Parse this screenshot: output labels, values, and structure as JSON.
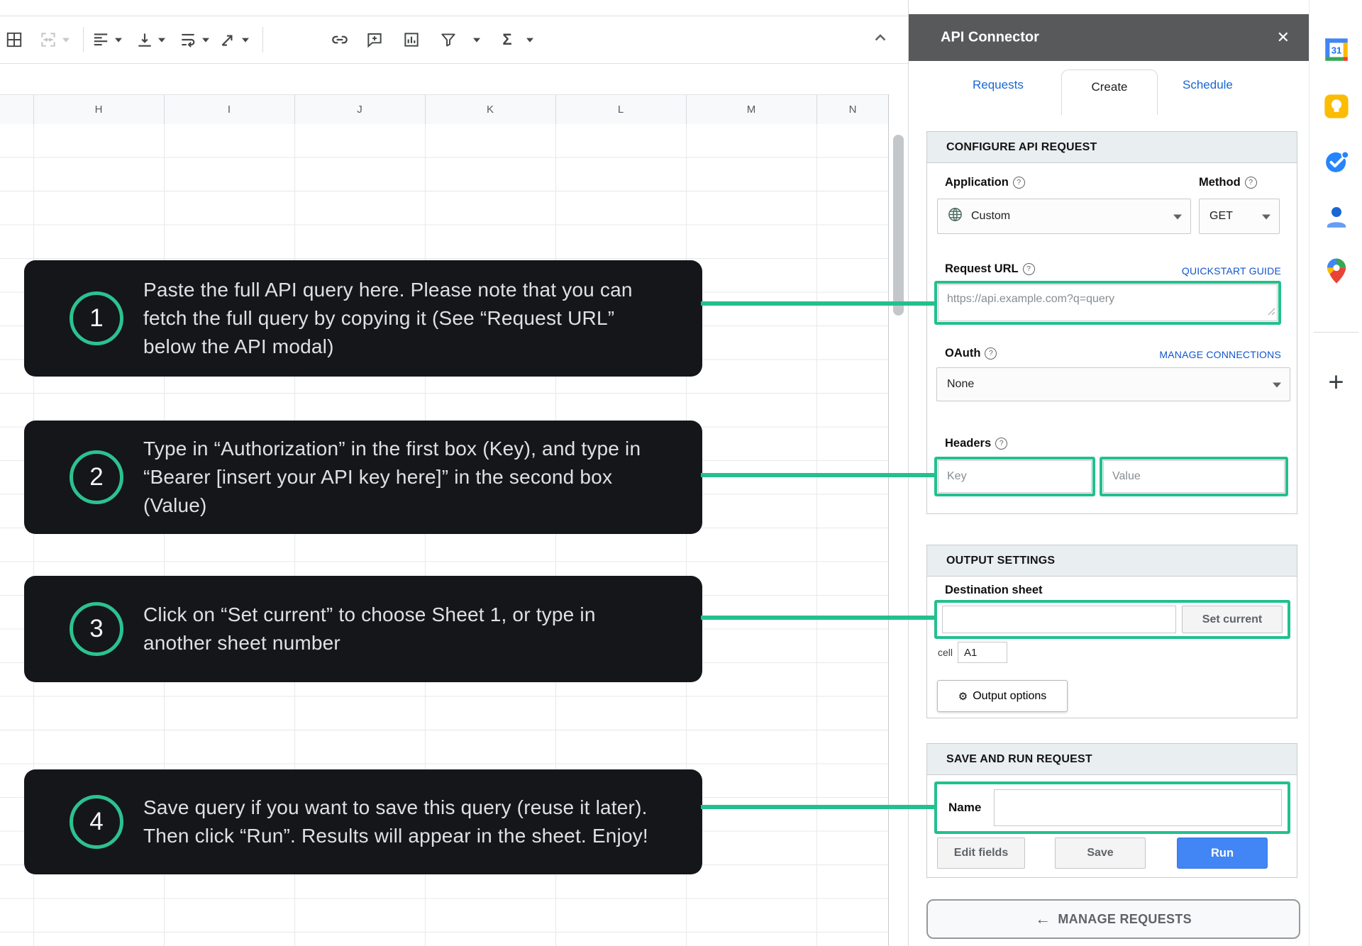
{
  "colors": {
    "accent_green": "#22c08e",
    "run_blue": "#4285f4",
    "link_blue": "#1155cc",
    "tab_blue": "#1967d2",
    "panel_header_gray": "#58595b",
    "callout_bg": "#14161a"
  },
  "toolbar": {
    "icons": [
      "borders",
      "merge-cells",
      "horizontal-align",
      "vertical-align",
      "text-wrap",
      "text-rotation",
      "insert-link",
      "insert-comment",
      "insert-chart",
      "create-filter",
      "functions"
    ],
    "sigma_glyph": "Σ"
  },
  "sheet": {
    "columns": [
      "H",
      "I",
      "J",
      "K",
      "L",
      "M",
      "N"
    ]
  },
  "callouts": [
    {
      "number": "1",
      "lines": [
        "Paste the full API query here. Please note that you can",
        "fetch the full query by copying it (See “Request URL”",
        "below the API modal)"
      ]
    },
    {
      "number": "2",
      "lines": [
        "Type in “Authorization” in the first box (Key), and type in",
        "“Bearer [insert your API key here]” in the second box",
        "(Value)"
      ]
    },
    {
      "number": "3",
      "lines": [
        "Click on “Set current” to choose Sheet 1, or type in",
        "another sheet number"
      ]
    },
    {
      "number": "4",
      "lines": [
        "Save query if you want to save this query (reuse it later).",
        "Then click “Run”. Results will appear in the sheet. Enjoy!"
      ]
    }
  ],
  "panel": {
    "title": "API Connector",
    "close_glyph": "✕",
    "help_glyph": "?",
    "tabs": [
      {
        "label": "Requests"
      },
      {
        "label": "Create"
      },
      {
        "label": "Schedule"
      }
    ],
    "configure": {
      "section_title": "CONFIGURE API REQUEST",
      "application_label": "Application",
      "application_value": "Custom",
      "method_label": "Method",
      "method_value": "GET",
      "request_url_label": "Request URL",
      "quickstart_link": "QUICKSTART GUIDE",
      "request_url_placeholder": "https://api.example.com?q=query",
      "oauth_label": "OAuth",
      "manage_connections_link": "MANAGE CONNECTIONS",
      "oauth_value": "None",
      "headers_label": "Headers",
      "key_placeholder": "Key",
      "value_placeholder": "Value"
    },
    "output": {
      "section_title": "OUTPUT SETTINGS",
      "destination_label": "Destination sheet",
      "set_current_button": "Set current",
      "cell_label": "cell",
      "cell_value": "A1",
      "gear_glyph": "⚙",
      "output_options_button": "Output options"
    },
    "save_run": {
      "section_title": "SAVE AND RUN REQUEST",
      "name_label": "Name",
      "edit_fields_button": "Edit fields",
      "save_button": "Save",
      "run_button": "Run"
    },
    "manage_arrow_glyph": "←",
    "manage_requests_button": "MANAGE REQUESTS"
  },
  "strip": {
    "icons": [
      "google-calendar",
      "google-keep",
      "google-tasks",
      "google-contacts",
      "google-maps"
    ],
    "calendar_label": "31",
    "plus_glyph": "+"
  }
}
